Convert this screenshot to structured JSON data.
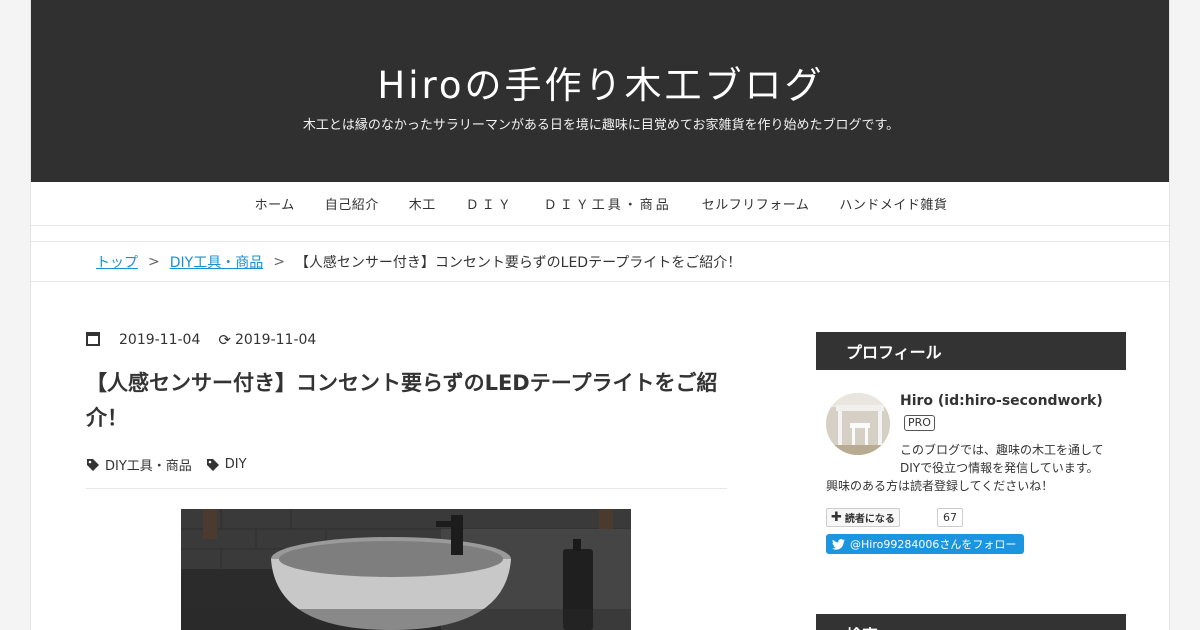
{
  "header": {
    "site_title": "Hiroの手作り木工ブログ",
    "site_description": "木工とは縁のなかったサラリーマンがある日を境に趣味に目覚めてお家雑貨を作り始めたブログです。"
  },
  "nav": {
    "items": [
      "ホーム",
      "自己紹介",
      "木工",
      "ＤＩＹ",
      "ＤＩＹ工具・商品",
      "セルフリフォーム",
      "ハンドメイド雑貨"
    ]
  },
  "breadcrumb": {
    "top": "トップ",
    "sep": ">",
    "category": "DIY工具・商品",
    "current": "【人感センサー付き】コンセント要らずのLEDテープライトをご紹介！"
  },
  "entry": {
    "date": "2019-11-04",
    "updated": "2019-11-04",
    "title": "【人感センサー付き】コンセント要らずのLEDテープライトをご紹介！",
    "tags": [
      "DIY工具・商品",
      "DIY"
    ]
  },
  "sidebar": {
    "profile_heading": "プロフィール",
    "profile_name": "Hiro (id:hiro-secondwork)",
    "pro_badge": "PRO",
    "profile_line1": "このブログでは、趣味の木工を通して",
    "profile_line2": "DIYで役立つ情報を発信しています。",
    "profile_line3": "興味のある方は読者登録してくださいね！",
    "reader_button": "読者になる",
    "reader_count": "67",
    "twitter_follow": "@Hiro99284006さんをフォロー",
    "search_heading": "検索"
  },
  "colors": {
    "header_bg": "#303030",
    "link": "#1a8fd1",
    "twitter": "#1b95e0"
  }
}
